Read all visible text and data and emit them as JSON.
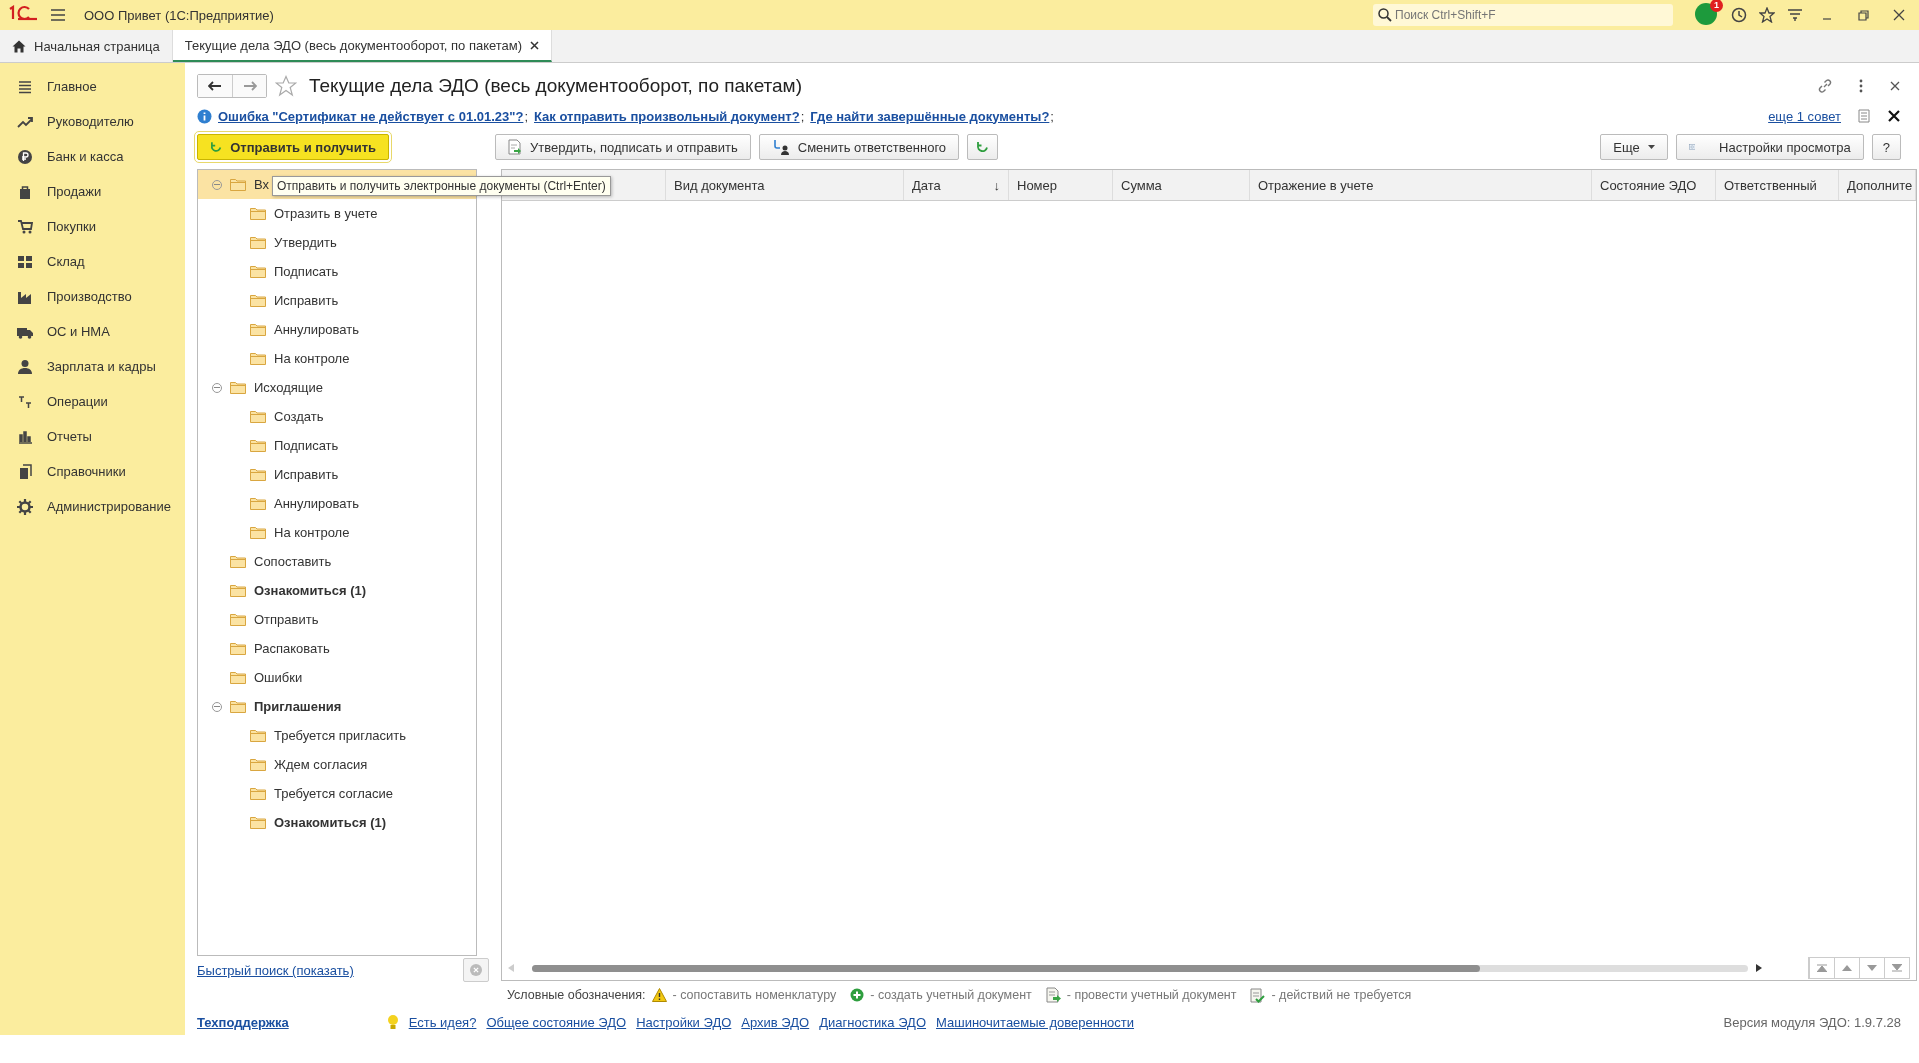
{
  "topbar": {
    "app_title": "ООО Привет  (1С:Предприятие)",
    "search_placeholder": "Поиск Ctrl+Shift+F",
    "notification_count": "1"
  },
  "tabs": [
    {
      "label": "Начальная страница",
      "selected": false,
      "closable": false
    },
    {
      "label": "Текущие дела ЭДО (весь документооборот, по пакетам)",
      "selected": true,
      "closable": true
    }
  ],
  "sidebar": {
    "items": [
      {
        "label": "Главное"
      },
      {
        "label": "Руководителю"
      },
      {
        "label": "Банк и касса"
      },
      {
        "label": "Продажи"
      },
      {
        "label": "Покупки"
      },
      {
        "label": "Склад"
      },
      {
        "label": "Производство"
      },
      {
        "label": "ОС и НМА"
      },
      {
        "label": "Зарплата и кадры"
      },
      {
        "label": "Операции"
      },
      {
        "label": "Отчеты"
      },
      {
        "label": "Справочники"
      },
      {
        "label": "Администрирование"
      }
    ]
  },
  "form": {
    "title": "Текущие дела ЭДО (весь документооборот, по пакетам)",
    "favorite": false,
    "tips": [
      {
        "text": "Ошибка \"Сертификат не действует с 01.01.23\"?",
        "separator": ";"
      },
      {
        "text": "Как отправить произвольный документ?",
        "separator": ";"
      },
      {
        "text": "Где найти завершённые документы?",
        "separator": ";"
      }
    ],
    "more_tips": "еще 1 совет",
    "toolbar": {
      "primary": "Отправить и получить",
      "approve": "Утвердить, подписать и отправить",
      "change_owner": "Сменить ответственного",
      "more": "Еще",
      "view_settings": "Настройки просмотра",
      "help": "?"
    },
    "tooltip": "Отправить и получить электронные документы (Ctrl+Enter)",
    "tree": [
      {
        "label": "Вх",
        "bold": false,
        "selected": true,
        "expanded": true,
        "children": [
          {
            "label": "Отразить в учете",
            "bold": false,
            "selected": false
          },
          {
            "label": "Утвердить",
            "bold": false,
            "selected": false
          },
          {
            "label": "Подписать",
            "bold": false,
            "selected": false
          },
          {
            "label": "Исправить",
            "bold": false,
            "selected": false
          },
          {
            "label": "Аннулировать",
            "bold": false,
            "selected": false
          },
          {
            "label": "На контроле",
            "bold": false,
            "selected": false
          }
        ]
      },
      {
        "label": "Исходящие",
        "bold": false,
        "selected": false,
        "expanded": true,
        "children": [
          {
            "label": "Создать",
            "bold": false,
            "selected": false
          },
          {
            "label": "Подписать",
            "bold": false,
            "selected": false
          },
          {
            "label": "Исправить",
            "bold": false,
            "selected": false
          },
          {
            "label": "Аннулировать",
            "bold": false,
            "selected": false
          },
          {
            "label": "На контроле",
            "bold": false,
            "selected": false
          }
        ]
      },
      {
        "label": "Сопоставить",
        "bold": false,
        "selected": false
      },
      {
        "label": "Ознакомиться (1)",
        "bold": true,
        "selected": false
      },
      {
        "label": "Отправить",
        "bold": false,
        "selected": false
      },
      {
        "label": "Распаковать",
        "bold": false,
        "selected": false
      },
      {
        "label": "Ошибки",
        "bold": false,
        "selected": false
      },
      {
        "label": "Приглашения",
        "bold": true,
        "selected": false,
        "expanded": true,
        "children": [
          {
            "label": "Требуется пригласить",
            "bold": false,
            "selected": false
          },
          {
            "label": "Ждем согласия",
            "bold": false,
            "selected": false
          },
          {
            "label": "Требуется согласие",
            "bold": false,
            "selected": false
          },
          {
            "label": "Ознакомиться (1)",
            "bold": true,
            "selected": false
          }
        ]
      }
    ],
    "table": {
      "columns": [
        {},
        {
          "label": "Вид документа"
        },
        {
          "label": "Дата",
          "sort": "↓"
        },
        {
          "label": "Номер"
        },
        {
          "label": "Сумма"
        },
        {
          "label": "Отражение в учете"
        },
        {
          "label": "Состояние ЭДО"
        },
        {
          "label": "Ответственный"
        },
        {
          "label": "Дополните"
        }
      ]
    },
    "quick_search": "Быстрый поиск (показать)",
    "legend": {
      "title": "Условные обозначения:",
      "items": [
        {
          "kind": "warning",
          "text": "- сопоставить номенклатуру"
        },
        {
          "kind": "plus",
          "text": "- создать учетный документ"
        },
        {
          "kind": "post",
          "text": "- провести учетный документ"
        },
        {
          "kind": "done",
          "text": "- действий не требуется"
        }
      ]
    },
    "footer": {
      "support": "Техподдержка",
      "links": [
        "Есть идея?",
        "Общее состояние ЭДО",
        "Настройки ЭДО",
        "Архив ЭДО",
        "Диагностика ЭДО",
        "Машиночитаемые доверенности"
      ],
      "version": "Версия модуля ЭДО: 1.9.7.28"
    }
  }
}
